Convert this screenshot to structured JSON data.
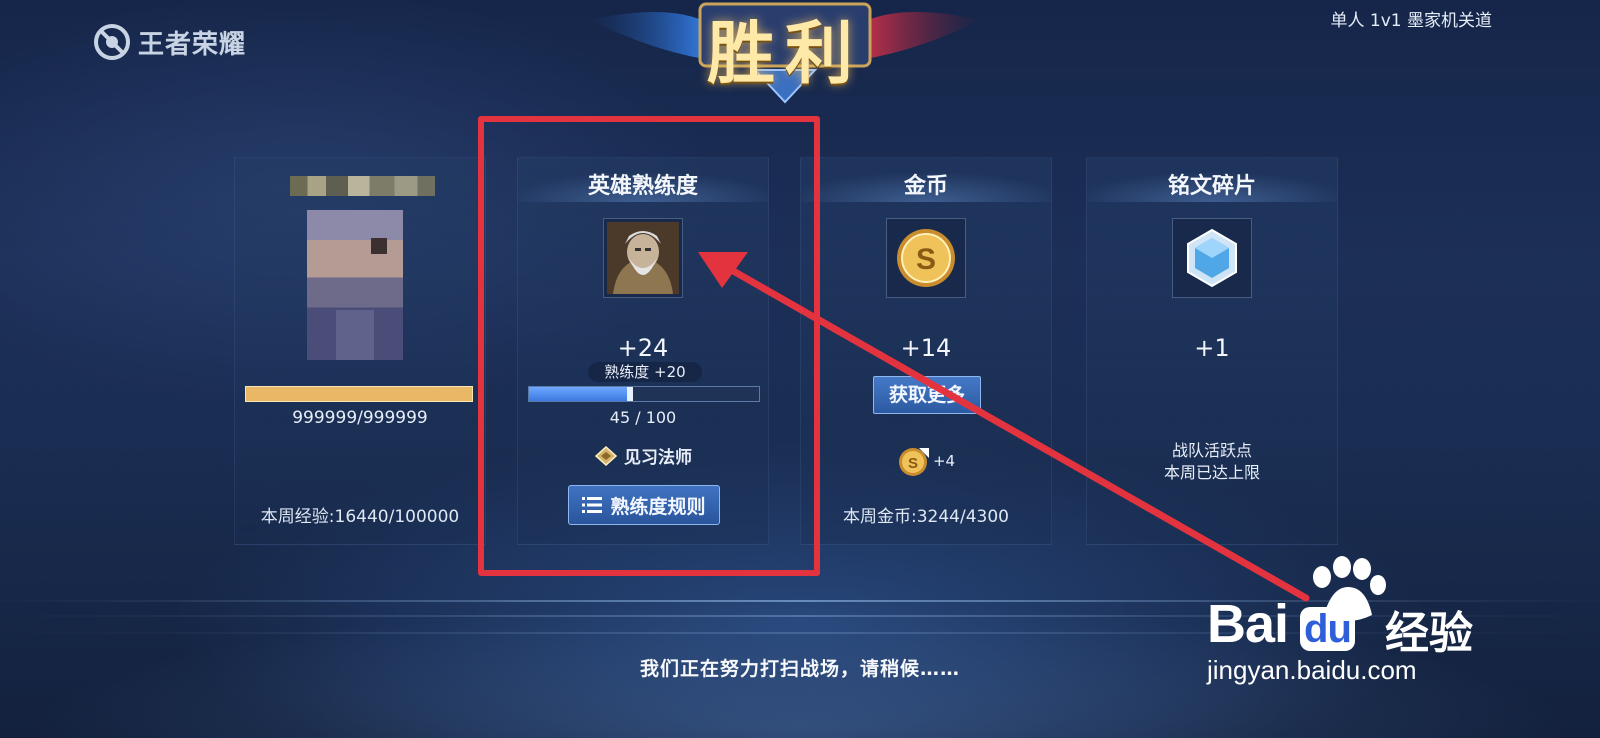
{
  "app": {
    "logo_text": "王者荣耀",
    "mode": "单人 1v1 墨家机关道"
  },
  "victory": {
    "title": "胜利"
  },
  "player_card": {
    "exp_value": "999999/999999",
    "weekly_exp": "本周经验:16440/100000"
  },
  "hero_card": {
    "title": "英雄熟练度",
    "gain": "+24",
    "mastery_gain": "熟练度 +20",
    "progress_text": "45 / 100",
    "progress_fraction": 0.45,
    "rank_label": "见习法师",
    "rules_button": "熟练度规则"
  },
  "gold_card": {
    "title": "金币",
    "gain": "+14",
    "get_more_button": "获取更多",
    "bonus": "+4",
    "weekly_gold": "本周金币:3244/4300"
  },
  "fragment_card": {
    "title": "铭文碎片",
    "gain": "+1",
    "team_line1": "战队活跃点",
    "team_line2": "本周已达上限"
  },
  "footer": {
    "waiting": "我们正在努力打扫战场，请稍候……"
  },
  "watermark": {
    "brand": "Bai",
    "brand_du": "du",
    "cn": "经验",
    "url": "jingyan.baidu.com"
  },
  "colors": {
    "annotation": "#e3333f",
    "progress": "#3a79e0",
    "gold_bar": "#e9b866"
  }
}
